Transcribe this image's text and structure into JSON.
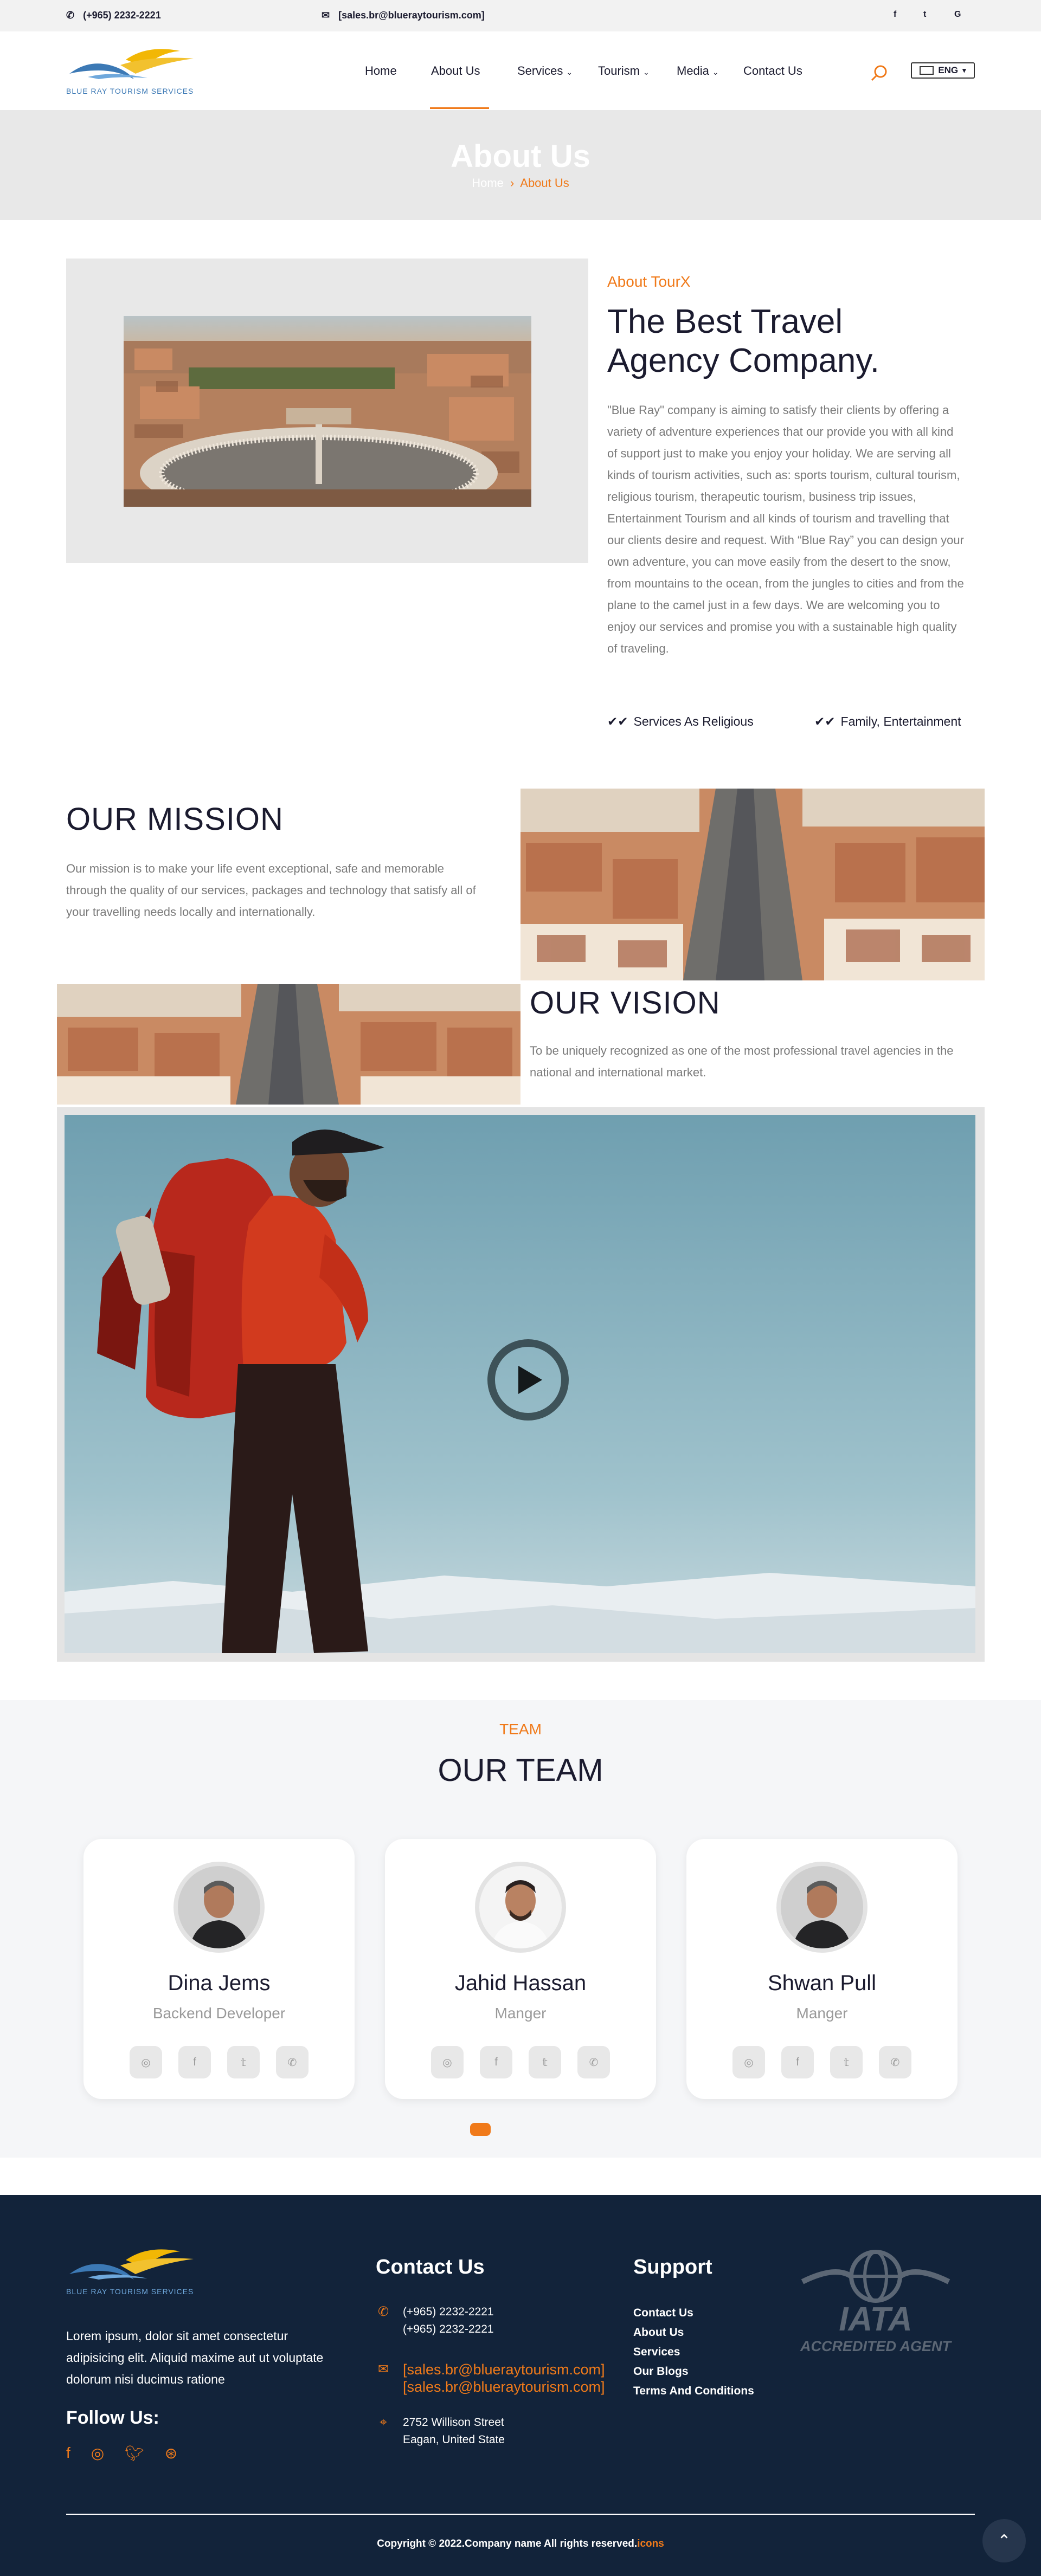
{
  "topbar": {
    "phone": "(+965) 2232-2221",
    "email": "[sales.br@blueraytourism.com]",
    "socials": [
      "f",
      "t",
      "G"
    ]
  },
  "brand": {
    "logo_text": "BLUE RAY TOURISM SERVICES",
    "accent_color": "#f07a1a",
    "navy_color": "#12233a"
  },
  "nav": {
    "items": [
      {
        "label": "Home"
      },
      {
        "label": "About Us"
      },
      {
        "label": "Services"
      },
      {
        "label": "Tourism"
      },
      {
        "label": "Media"
      },
      {
        "label": "Contact Us"
      }
    ],
    "language": "ENG"
  },
  "banner": {
    "title": "About Us",
    "crumb_home": "Home",
    "crumb_current": "About Us"
  },
  "about": {
    "tag": "About TourX",
    "heading": "The Best Travel Agency Company.",
    "text": "\"Blue Ray\" company is aiming to satisfy their clients by offering a variety of adventure experiences that our provide you with all kind of support just to make you enjoy your holiday. We are serving all kinds of tourism activities, such as: sports tourism, cultural tourism, religious tourism, therapeutic tourism, business trip issues, Entertainment Tourism and all kinds of tourism and travelling that our clients desire and request. With “Blue Ray” you can design your own adventure, you can move easily from the desert to the snow, from mountains to the ocean, from the jungles to cities and from the plane to the camel just in a few days. We are welcoming you to enjoy our services and promise you with a sustainable high quality of traveling.",
    "features": [
      "Services As Religious",
      "Family, Entertainment"
    ]
  },
  "mission": {
    "title": "OUR MISSION",
    "text": "Our mission is to make your life event exceptional, safe and memorable through the quality of our services, packages and technology that satisfy all of your travelling needs locally and internationally."
  },
  "vision": {
    "title": "OUR VISION",
    "text": "To be uniquely recognized as one of the most professional travel agencies in the national and international market."
  },
  "team": {
    "tag": "TEAM",
    "title": "OUR TEAM",
    "members": [
      {
        "name": "Dina Jems",
        "role": "Backend Developer"
      },
      {
        "name": "Jahid Hassan",
        "role": "Manger"
      },
      {
        "name": "Shwan Pull",
        "role": "Manger"
      }
    ]
  },
  "footer": {
    "about": "Lorem ipsum, dolor sit amet consectetur adipisicing elit. Aliquid maxime aut ut voluptate dolorum nisi ducimus ratione",
    "follow_title": "Follow Us:",
    "contact_title": "Contact Us",
    "phone_1": "(+965) 2232-2221",
    "phone_2": "(+965) 2232-2221",
    "email_1": "[sales.br@blueraytourism.com]",
    "email_2": "[sales.br@blueraytourism.com]",
    "address_1": "2752 Willison Street",
    "address_2": "Eagan, United State",
    "support_title": "Support",
    "support_links": [
      "Contact Us",
      "About Us",
      "Services",
      "Our Blogs",
      "Terms And Conditions"
    ],
    "iata_line1": "IATA",
    "iata_line2": "ACCREDITED AGENT",
    "copyright": "Copyright © 2022.Company name All rights reserved.",
    "copyright_link": "icons"
  }
}
